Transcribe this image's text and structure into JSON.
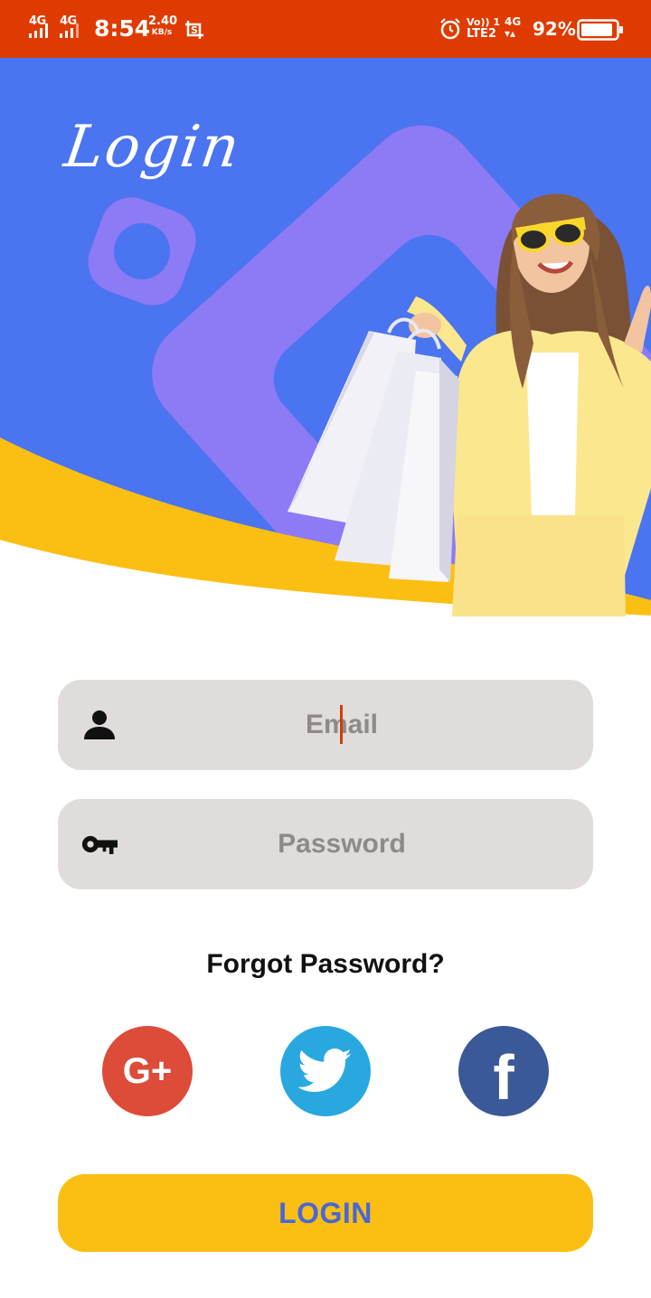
{
  "status_bar": {
    "signal_1_label": "4G",
    "signal_2_label": "4G",
    "time": "8:54",
    "net_speed_value": "2.40",
    "net_speed_unit": "KB/s",
    "volte_top": "Vo)) 1",
    "volte_bottom": "LTE2",
    "sim2_label": "4G",
    "battery_percent": "92%",
    "battery_level": 0.92,
    "icons": [
      "signal-icon",
      "screenshot-icon",
      "alarm-icon",
      "battery-icon"
    ]
  },
  "hero": {
    "title": "Login",
    "colors": {
      "background": "#4a74f0",
      "shape": "#8d7af5",
      "wave": "#fbbf13"
    }
  },
  "form": {
    "email": {
      "value": "",
      "placeholder": "Email",
      "icon": "user-icon"
    },
    "password": {
      "value": "",
      "placeholder": "Password",
      "icon": "key-icon"
    }
  },
  "forgot_password": "Forgot Password?",
  "social": {
    "google": {
      "label": "G+",
      "color": "#dd4b39"
    },
    "twitter": {
      "icon": "twitter-bird-icon",
      "color": "#29a8e0"
    },
    "facebook": {
      "label": "f",
      "color": "#3b5998"
    }
  },
  "login_button": {
    "label": "LOGIN",
    "bg": "#fbbf13",
    "text_color": "#4a67d6"
  }
}
